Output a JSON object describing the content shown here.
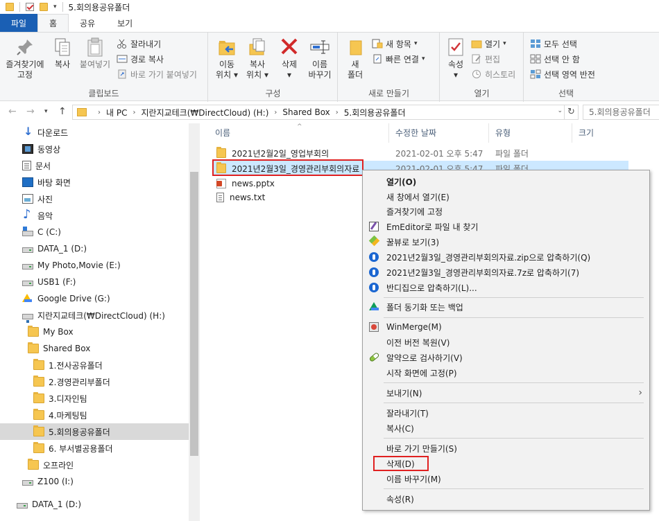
{
  "window": {
    "title": "5.회의용공유폴더"
  },
  "tabs": [
    {
      "label": "파일"
    },
    {
      "label": "홈"
    },
    {
      "label": "공유"
    },
    {
      "label": "보기"
    }
  ],
  "ribbon": {
    "clipboard": {
      "label": "클립보드",
      "pin_line1": "즐겨찾기에",
      "pin_line2": "고정",
      "copy": "복사",
      "paste": "붙여넣기",
      "cut": "잘라내기",
      "copy_path": "경로 복사",
      "paste_shortcut": "바로 가기 붙여넣기"
    },
    "organize": {
      "label": "구성",
      "move_line1": "이동",
      "move_line2": "위치",
      "copyto_line1": "복사",
      "copyto_line2": "위치",
      "delete": "삭제",
      "rename_line1": "이름",
      "rename_line2": "바꾸기"
    },
    "new": {
      "label": "새로 만들기",
      "folder_line1": "새",
      "folder_line2": "폴더",
      "new_item": "새 항목",
      "easy_access": "빠른 연결"
    },
    "open": {
      "label": "열기",
      "properties": "속성",
      "open": "열기",
      "edit": "편집",
      "history": "히스토리"
    },
    "select": {
      "label": "선택",
      "select_all": "모두 선택",
      "select_none": "선택 안 함",
      "invert": "선택 영역 반전"
    }
  },
  "address": {
    "crumbs": [
      "내 PC",
      "지란지교테크(₩DirectCloud) (H:)",
      "Shared Box",
      "5.회의용공유폴더"
    ],
    "search_placeholder": "5.회의용공유폴더"
  },
  "nav": [
    {
      "label": "다운로드"
    },
    {
      "label": "동영상"
    },
    {
      "label": "문서"
    },
    {
      "label": "바탕 화면"
    },
    {
      "label": "사진"
    },
    {
      "label": "음악"
    },
    {
      "label": "C (C:)"
    },
    {
      "label": "DATA_1 (D:)"
    },
    {
      "label": "My Photo,Movie (E:)"
    },
    {
      "label": "USB1 (F:)"
    },
    {
      "label": "Google Drive (G:)"
    },
    {
      "label": "지란지교테크(₩DirectCloud) (H:)"
    },
    {
      "label": "My Box"
    },
    {
      "label": "Shared Box"
    },
    {
      "label": "1.전사공유폴더"
    },
    {
      "label": "2.경영관리부폴더"
    },
    {
      "label": "3.디자인팀"
    },
    {
      "label": "4.마케팅팀"
    },
    {
      "label": "5.회의용공유폴더"
    },
    {
      "label": "6. 부서별공용폴더"
    },
    {
      "label": "오프라인"
    },
    {
      "label": "Z100 (I:)"
    },
    {
      "label": "DATA_1 (D:)"
    }
  ],
  "columns": {
    "name": "이름",
    "date": "수정한 날짜",
    "type": "유형",
    "size": "크기"
  },
  "files": [
    {
      "name": "2021년2월2일_영업부회의",
      "date": "2021-02-01 오후 5:47",
      "type": "파일 폴더"
    },
    {
      "name": "2021년2월3일_경영관리부회의자료",
      "date": "2021-02-01 오후 5:47",
      "type": "파일 폴더"
    },
    {
      "name": "news.pptx",
      "date": "",
      "type": ""
    },
    {
      "name": "news.txt",
      "date": "",
      "type": ""
    }
  ],
  "context_menu": {
    "items": [
      {
        "label": "열기(O)"
      },
      {
        "label": "새 창에서 열기(E)"
      },
      {
        "label": "즐겨찾기에 고정"
      },
      {
        "label": "EmEditor로 파일 내 찾기"
      },
      {
        "label": "꿀뷰로 보기(3)"
      },
      {
        "label": "2021년2월3일_경영관리부회의자료.zip으로 압축하기(Q)"
      },
      {
        "label": "2021년2월3일_경영관리부회의자료.7z로 압축하기(7)"
      },
      {
        "label": "반디집으로 압축하기(L)..."
      },
      {
        "label": "폴더 동기화 또는 백업"
      },
      {
        "label": "WinMerge(M)"
      },
      {
        "label": "이전 버전 복원(V)"
      },
      {
        "label": "알약으로 검사하기(V)"
      },
      {
        "label": "시작 화면에 고정(P)"
      },
      {
        "label": "보내기(N)"
      },
      {
        "label": "잘라내기(T)"
      },
      {
        "label": "복사(C)"
      },
      {
        "label": "바로 가기 만들기(S)"
      },
      {
        "label": "삭제(D)"
      },
      {
        "label": "이름 바꾸기(M)"
      },
      {
        "label": "속성(R)"
      }
    ]
  },
  "colors": {
    "selection": "#cce8ff",
    "highlight": "#e02020",
    "file_tab": "#1a5fb4"
  }
}
